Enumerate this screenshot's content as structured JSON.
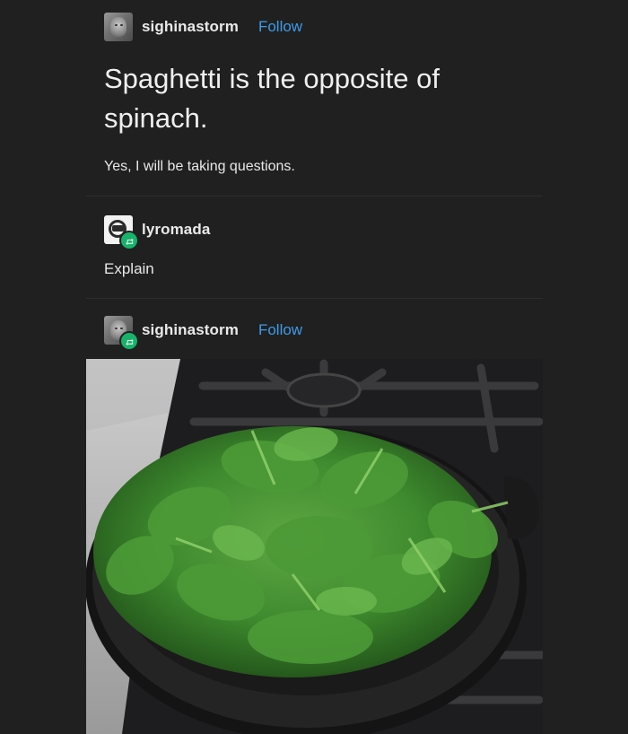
{
  "post1": {
    "username": "sighinastorm",
    "follow_label": "Follow",
    "title": "Spaghetti is the opposite of spinach.",
    "subtitle": "Yes, I will be taking questions."
  },
  "post2": {
    "username": "lyromada",
    "text": "Explain"
  },
  "post3": {
    "username": "sighinastorm",
    "follow_label": "Follow"
  },
  "colors": {
    "background": "#202020",
    "follow_link": "#3d9be9",
    "reblog_badge": "#19b26a"
  },
  "icons": {
    "reblog": "reblog-icon"
  }
}
